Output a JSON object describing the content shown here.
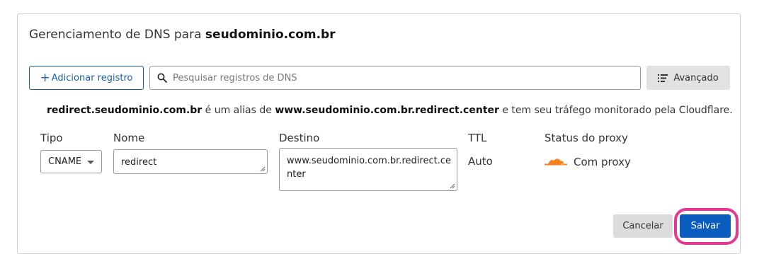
{
  "header": {
    "title_prefix": "Gerenciamento de DNS para",
    "domain": "seudominio.com.br"
  },
  "toolbar": {
    "add_plus": "+",
    "add_label": "Adicionar registro",
    "search_placeholder": "Pesquisar registros de DNS",
    "search_value": "",
    "advanced_label": "Avançado"
  },
  "alias_notice": {
    "host": "redirect.seudominio.com.br",
    "middle": " é um alias de ",
    "target": "www.seudominio.com.br.redirect.center",
    "suffix": " e tem seu tráfego monitorado pela Cloudflare."
  },
  "form": {
    "labels": {
      "type": "Tipo",
      "name": "Nome",
      "target": "Destino",
      "ttl": "TTL",
      "proxy_status": "Status do proxy"
    },
    "type_value": "CNAME",
    "name_value": "redirect",
    "target_line1": "www.seudominio.com.br.redirect.ce",
    "target_line2": "nter",
    "ttl_value": "Auto",
    "proxy_value": "Com proxy"
  },
  "actions": {
    "cancel_label": "Cancelar",
    "save_label": "Salvar"
  },
  "colors": {
    "primary": "#0a5dbf",
    "link": "#1a5fa8",
    "highlight": "#e5398f",
    "cloud": "#f48120"
  },
  "icons": {
    "search": "search-icon",
    "advanced": "filter-list-icon",
    "proxy": "cloudflare-cloud-icon"
  }
}
